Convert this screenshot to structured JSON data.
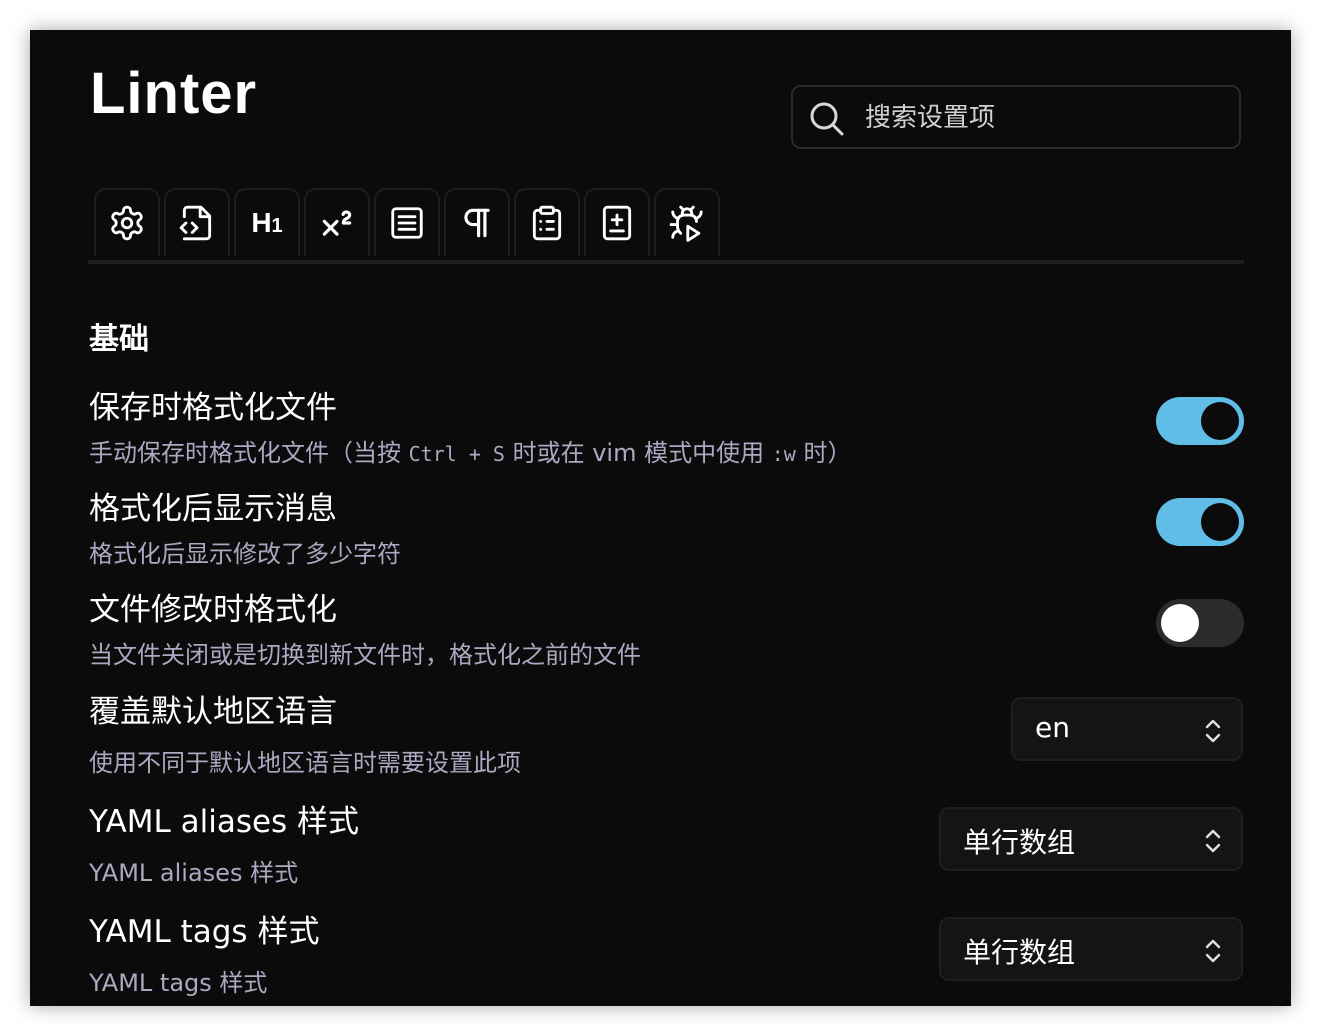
{
  "title": "Linter",
  "search": {
    "placeholder": "搜索设置项",
    "icon": "search-icon"
  },
  "tabs": [
    {
      "name": "general",
      "icon": "gear-icon"
    },
    {
      "name": "yaml",
      "icon": "file-code-icon"
    },
    {
      "name": "heading",
      "icon": "heading-icon",
      "label": "H",
      "sub": "1"
    },
    {
      "name": "footnote",
      "icon": "superscript-icon"
    },
    {
      "name": "content",
      "icon": "list-box-icon"
    },
    {
      "name": "spacing",
      "icon": "pilcrow-icon"
    },
    {
      "name": "paste",
      "icon": "clipboard-list-icon"
    },
    {
      "name": "custom",
      "icon": "file-plus-icon"
    },
    {
      "name": "debug",
      "icon": "bug-play-icon"
    }
  ],
  "section_title": "基础",
  "settings": {
    "format_on_save": {
      "name": "保存时格式化文件",
      "desc_prefix": "手动保存时格式化文件（当按 ",
      "code1": "Ctrl + S",
      "desc_mid": " 时或在 vim 模式中使用 ",
      "code2": ":w",
      "desc_suffix": " 时）",
      "enabled": true
    },
    "display_message": {
      "name": "格式化后显示消息",
      "desc": "格式化后显示修改了多少字符",
      "enabled": true
    },
    "lint_on_file_change": {
      "name": "文件修改时格式化",
      "desc": "当文件关闭或是切换到新文件时，格式化之前的文件",
      "enabled": false
    },
    "override_locale": {
      "name": "覆盖默认地区语言",
      "desc": "使用不同于默认地区语言时需要设置此项",
      "value": "en"
    },
    "yaml_aliases": {
      "name": "YAML aliases 样式",
      "desc": "YAML aliases 样式",
      "value": "单行数组"
    },
    "yaml_tags": {
      "name": "YAML tags 样式",
      "desc": "YAML tags 样式",
      "value": "单行数组"
    }
  },
  "colors": {
    "background": "#0b0b0b",
    "accent": "#5fbde8",
    "description": "#a9a9c2"
  }
}
